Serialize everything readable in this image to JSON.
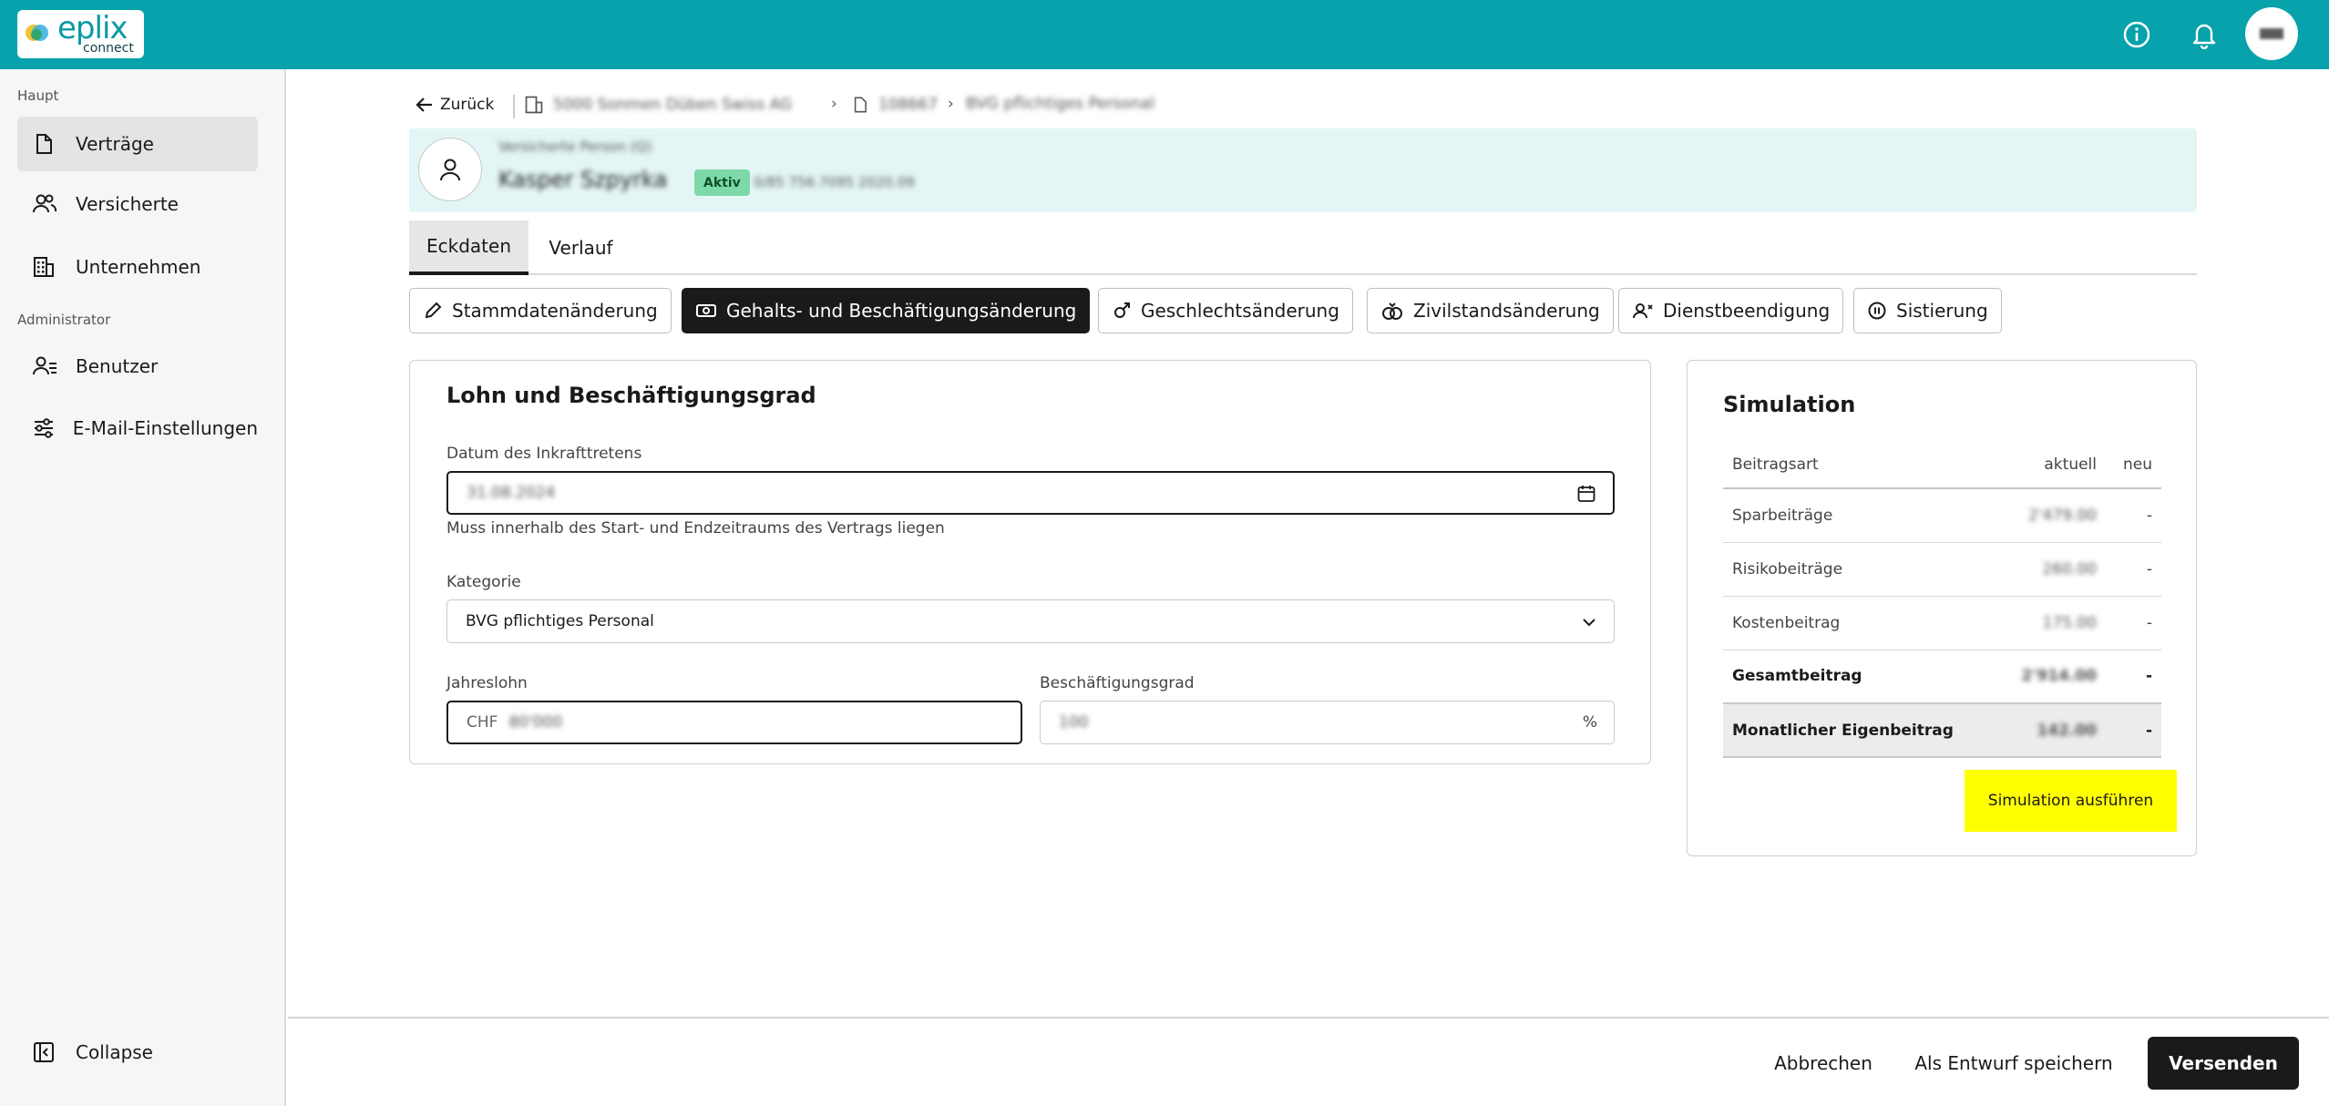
{
  "brand": {
    "name": "eplix",
    "sub": "connect"
  },
  "header": {
    "info_icon": "info-icon",
    "bell_icon": "bell-icon",
    "avatar_initials": "■■"
  },
  "sidebar": {
    "sections": [
      {
        "title": "Haupt",
        "items": [
          {
            "label": "Verträge",
            "icon": "document-icon",
            "active": true
          },
          {
            "label": "Versicherte",
            "icon": "users-icon",
            "active": false
          },
          {
            "label": "Unternehmen",
            "icon": "building-icon",
            "active": false
          }
        ]
      },
      {
        "title": "Administrator",
        "items": [
          {
            "label": "Benutzer",
            "icon": "user-list-icon",
            "active": false
          },
          {
            "label": "E-Mail-Einstellungen",
            "icon": "sliders-icon",
            "active": false
          }
        ]
      }
    ],
    "collapse_label": "Collapse"
  },
  "breadcrumb": {
    "back_label": "Zurück",
    "company": "5000 Sonmen Düben Swiss AG",
    "contract": "108667",
    "category": "BVG pflichtiges Personal"
  },
  "person": {
    "subtitle": "Versicherte Person (Q)",
    "name": "Kasper Szpyrka",
    "status": "Aktiv",
    "meta": "0/85 756.7095 2020.09"
  },
  "tabs": [
    {
      "label": "Eckdaten",
      "active": true
    },
    {
      "label": "Verlauf",
      "active": false
    }
  ],
  "actions": [
    {
      "label": "Stammdatenänderung",
      "icon": "pencil-icon",
      "active": false
    },
    {
      "label": "Gehalts- und Beschäftigungsänderung",
      "icon": "money-icon",
      "active": true
    },
    {
      "label": "Geschlechtsänderung",
      "icon": "gender-icon",
      "active": false
    },
    {
      "label": "Zivilstandsänderung",
      "icon": "rings-icon",
      "active": false
    },
    {
      "label": "Dienstbeendigung",
      "icon": "user-remove-icon",
      "active": false
    },
    {
      "label": "Sistierung",
      "icon": "pause-icon",
      "active": false
    }
  ],
  "form": {
    "title": "Lohn und Beschäftigungsgrad",
    "date_label": "Datum des Inkrafttretens",
    "date_value": "31.08.2024",
    "date_help": "Muss innerhalb des Start- und Endzeitraums des Vertrags liegen",
    "category_label": "Kategorie",
    "category_value": "BVG pflichtiges Personal",
    "salary_label": "Jahreslohn",
    "salary_prefix": "CHF",
    "salary_value": "80'000",
    "degree_label": "Beschäftigungsgrad",
    "degree_value": "100",
    "degree_suffix": "%"
  },
  "simulation": {
    "title": "Simulation",
    "headers": [
      "Beitragsart",
      "aktuell",
      "neu"
    ],
    "rows": [
      {
        "label": "Sparbeiträge",
        "current": "2'479.00",
        "new": "-"
      },
      {
        "label": "Risikobeiträge",
        "current": "260.00",
        "new": "-"
      },
      {
        "label": "Kostenbeitrag",
        "current": "175.00",
        "new": "-"
      },
      {
        "label": "Gesamtbeitrag",
        "current": "2'914.00",
        "new": "-"
      },
      {
        "label": "Monatlicher Eigenbeitrag",
        "current": "142.00",
        "new": "-"
      }
    ],
    "run_label": "Simulation ausführen"
  },
  "footer": {
    "cancel_label": "Abbrechen",
    "draft_label": "Als Entwurf speichern",
    "send_label": "Versenden"
  }
}
